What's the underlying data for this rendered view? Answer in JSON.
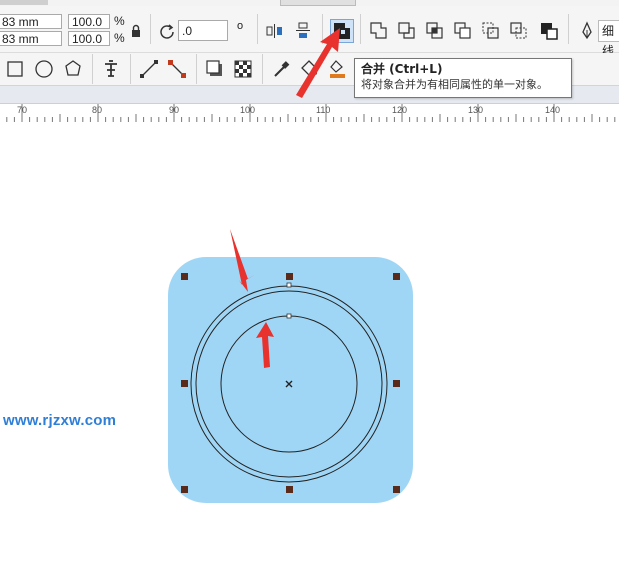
{
  "property_bar": {
    "width_value": "83 mm",
    "height_value": "83 mm",
    "scale_x": "100.0",
    "scale_y": "100.0",
    "percent_symbol": "%",
    "rotation_value": ".0",
    "degree_symbol": "o",
    "outline_width_label": "细线"
  },
  "tooltip": {
    "title": "合并 (Ctrl+L)",
    "description": "将对象合并为有相同属性的单一对象。"
  },
  "ruler": {
    "labels": [
      "70",
      "80",
      "90",
      "100",
      "110",
      "120",
      "130",
      "140"
    ]
  },
  "canvas": {
    "shape_fill_color": "#a0d6f5",
    "handle_color": "#5a2a1a",
    "annotation_color": "#e8322e"
  },
  "watermark": {
    "text": "www.rjzxw.com"
  },
  "icons": [
    "lock-icon",
    "rotate-icon",
    "mirror-horizontal-icon",
    "mirror-vertical-icon",
    "combine-icon",
    "weld-icon",
    "trim-icon",
    "intersect-icon",
    "simplify-icon",
    "front-minus-back-icon",
    "back-minus-front-icon",
    "boundary-icon",
    "pen-icon",
    "rectangle-tool-icon",
    "ellipse-tool-icon",
    "polygon-tool-icon",
    "text-tool-icon",
    "line-tool-icon",
    "connector-tool-icon",
    "drop-shadow-icon",
    "transparency-icon",
    "eyedropper-icon",
    "fill-icon",
    "interactive-fill-icon"
  ]
}
